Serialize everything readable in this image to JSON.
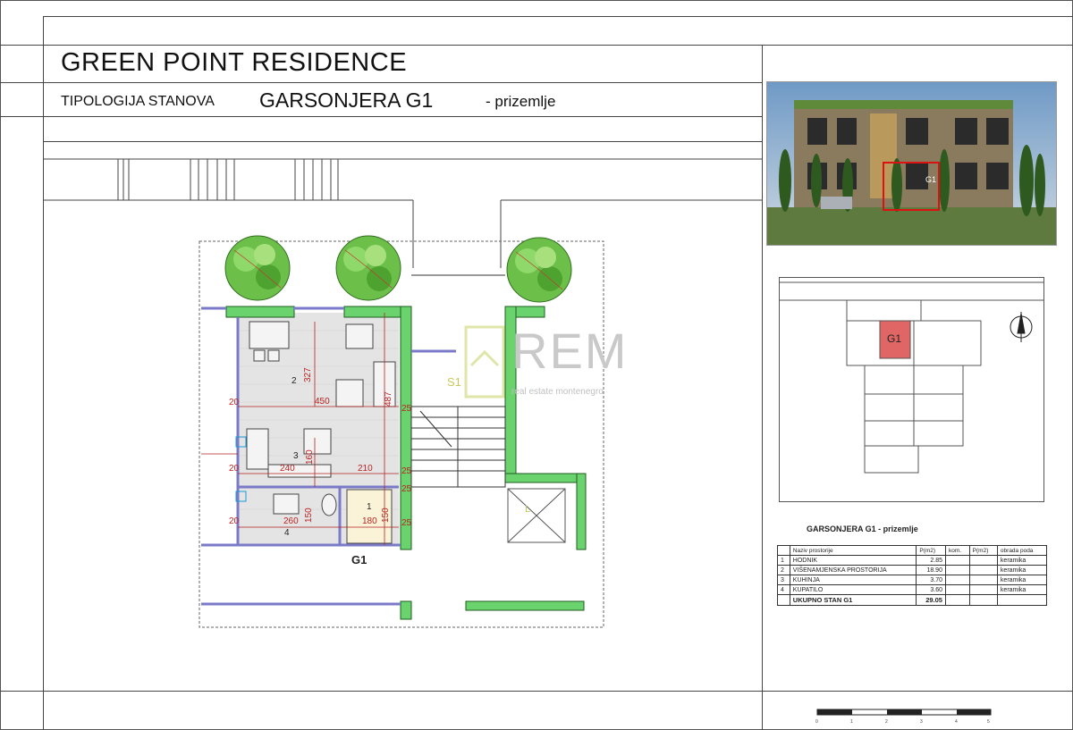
{
  "header": {
    "project_title": "GREEN POINT RESIDENCE",
    "typology_label": "TIPOLOGIJA STANOVA",
    "unit_name": "GARSONJERA G1",
    "floor_suffix": "- prizemlje"
  },
  "plan": {
    "unit_label": "G1",
    "stair_label": "S1",
    "elevator_label": "L",
    "rooms": [
      "1",
      "2",
      "3",
      "4"
    ],
    "dimensions": [
      "327",
      "450",
      "487",
      "20",
      "240",
      "160",
      "210",
      "20",
      "260",
      "150",
      "180",
      "150",
      "20",
      "25",
      "25",
      "25",
      "25"
    ]
  },
  "watermark": {
    "brand": "REM",
    "tagline": "real estate montenegro"
  },
  "render": {
    "unit_tag": "G1"
  },
  "keyplan": {
    "unit_tag": "G1",
    "highlight_color": "#e06666"
  },
  "area_table": {
    "title": "GARSONJERA G1 - prizemlje",
    "headers": [
      "Naziv prostorije",
      "P(m2)",
      "kom.",
      "P(m2)",
      "obrada poda"
    ],
    "rows": [
      {
        "no": "1",
        "name": "HODNIK",
        "area": "2.85",
        "floor": "keramika"
      },
      {
        "no": "2",
        "name": "VIŠENAMJENSKA PROSTORIJA",
        "area": "18.90",
        "floor": "keramika"
      },
      {
        "no": "3",
        "name": "KUHINJA",
        "area": "3.70",
        "floor": "keramika"
      },
      {
        "no": "4",
        "name": "KUPATILO",
        "area": "3.60",
        "floor": "keramika"
      }
    ],
    "total_label": "UKUPNO STAN G1",
    "total_area": "29.05"
  },
  "scale_bar": {
    "ticks": [
      "0",
      "1",
      "2",
      "3",
      "4",
      "5"
    ]
  },
  "colors": {
    "wall_green": "#3cb043",
    "dimension_red": "#b22222",
    "tree_green": "#4caf2a"
  }
}
